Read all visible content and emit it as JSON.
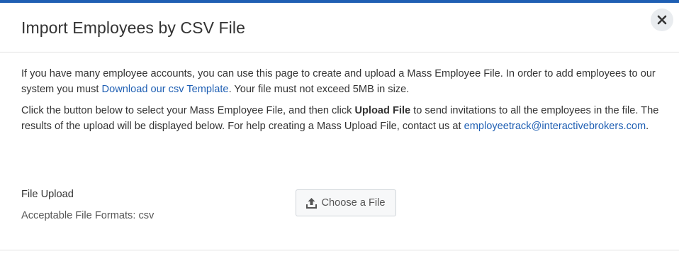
{
  "header": {
    "title": "Import Employees by CSV File",
    "close_icon": "close-icon"
  },
  "intro": {
    "text1": "If you have many employee accounts, you can use this page to create and upload a Mass Employee File. In order to add employees to our system you must ",
    "template_link": "Download our csv Template",
    "text2": ". Your file must not exceed 5MB in size."
  },
  "instructions": {
    "text1": "Click the button below to select your Mass Employee File, and then click ",
    "bold": "Upload File",
    "text2": " to send invitations to all the employees in the file. The results of the upload will be displayed below. For help creating a Mass Upload File, contact us at ",
    "email_link": "employeetrack@interactivebrokers.com",
    "text3": "."
  },
  "upload": {
    "label": "File Upload",
    "formats": "Acceptable File Formats: csv",
    "button_label": "Choose a File",
    "button_icon": "upload-icon"
  },
  "colors": {
    "accent": "#1f5fb3",
    "text": "#333333",
    "border": "#e2e2e2"
  }
}
